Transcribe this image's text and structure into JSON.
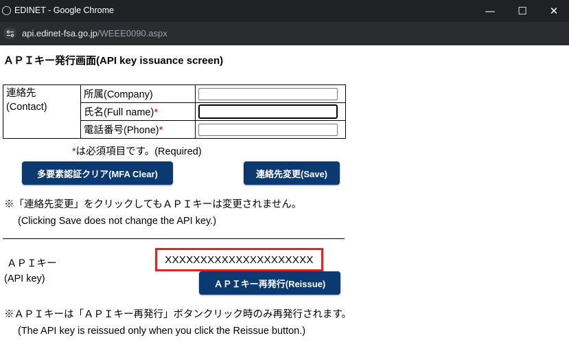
{
  "window": {
    "title": "EDINET - Google Chrome",
    "controls": {
      "minimize": "—",
      "maximize": "☐",
      "close": "✕"
    }
  },
  "address_bar": {
    "host": "api.edinet-fsa.go.jp",
    "path": "/WEEE0090.aspx"
  },
  "page": {
    "heading": "ＡＰＩキー発行画面(API key issuance screen)",
    "contact": {
      "label_line1": "連絡先",
      "label_line2": "(Contact)",
      "fields": [
        {
          "label": "所属(Company)",
          "required": "",
          "value": ""
        },
        {
          "label": "氏名(Full name)",
          "required": "*",
          "value": ""
        },
        {
          "label": "電話番号(Phone)",
          "required": "*",
          "value": ""
        }
      ]
    },
    "required_note": {
      "star": "*",
      "text": "は必須項目です。(Required)"
    },
    "buttons": {
      "mfa_clear": "多要素認証クリア(MFA Clear)",
      "save": "連絡先変更(Save)",
      "reissue": "ＡＰＩキー再発行(Reissue)"
    },
    "save_note": {
      "line1": "※「連絡先変更」をクリックしてもＡＰＩキーは変更されません。",
      "line2": "(Clicking Save does not change the API key.)"
    },
    "api_key": {
      "label_line1": "ＡＰＩキー",
      "label_line2": "(API key)",
      "value": "XXXXXXXXXXXXXXXXXXXXX",
      "highlight_color": "#d9262a"
    },
    "reissue_note": {
      "line1": "※ＡＰＩキーは「ＡＰＩキー再発行」ボタンクリック時のみ再発行されます。",
      "line2": "(The API key is reissued only when you click the Reissue button.)"
    }
  },
  "colors": {
    "button_bg": "#0b3a73",
    "titlebar_bg": "#202124",
    "required_mark": "#cc0000"
  }
}
